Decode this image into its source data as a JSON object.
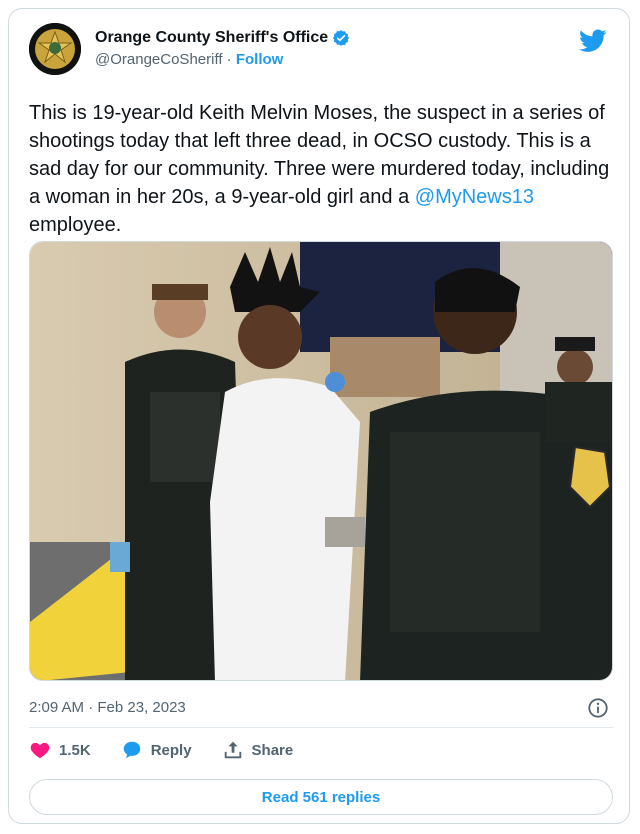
{
  "account": {
    "name": "Orange County Sheriff's Office",
    "handle": "@OrangeCoSheriff",
    "separator": " · ",
    "follow_label": "Follow"
  },
  "tweet": {
    "text_before_mention": "This is 19-year-old Keith Melvin Moses, the suspect in a series of shootings today that left three dead, in OCSO custody. This is a sad day for our community. Three were murdered today, including a woman in her 20s, a 9-year-old girl and a ",
    "mention": "@MyNews13",
    "text_after_mention": " employee.",
    "timestamp": "2:09 AM · Feb 23, 2023"
  },
  "actions": {
    "like_count": "1.5K",
    "reply_label": "Reply",
    "share_label": "Share",
    "read_replies_label": "Read 561 replies"
  },
  "colors": {
    "link": "#1d9bf0",
    "like": "#f91880",
    "muted": "#536471",
    "border": "#cfd9de"
  },
  "icons": {
    "verified": "verified-badge-icon",
    "twitter": "twitter-bird-icon",
    "info": "info-icon",
    "like": "heart-icon",
    "reply": "speech-bubble-icon",
    "share": "share-arrow-icon"
  }
}
